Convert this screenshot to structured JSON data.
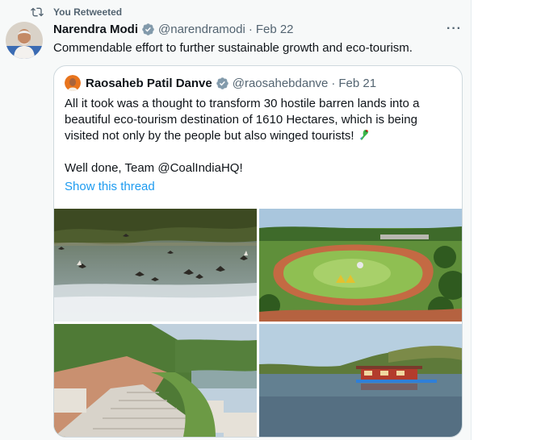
{
  "retweet": {
    "label": "You Retweeted",
    "icon": "retweet-icon"
  },
  "tweet": {
    "author_name": "Narendra Modi",
    "handle": "@narendramodi",
    "separator": "·",
    "date": "Feb 22",
    "text": "Commendable effort to further sustainable growth and eco-tourism.",
    "more_label": "···"
  },
  "quote": {
    "author_name": "Raosaheb Patil Danve",
    "handle": "@raosahebdanve",
    "separator": "·",
    "date": "Feb 21",
    "text_para1": "All it took was a thought to transform 30 hostile barren lands into a beautiful eco-tourism destination of 1610 Hectares, which is being visited not only by the people but also winged tourists!",
    "text_para2": "Well done, Team @CoalIndiaHQ!",
    "show_thread": "Show this thread",
    "emoji": "parrot-emoji"
  },
  "photos": [
    {
      "name": "photo-birds-over-lake"
    },
    {
      "name": "photo-eco-park-garden"
    },
    {
      "name": "photo-stairway-to-lake"
    },
    {
      "name": "photo-lake-houseboat"
    }
  ],
  "colors": {
    "link": "#1d9bf0",
    "verified": "#829aab",
    "secondary_text": "#536471",
    "border": "#cfd9de"
  }
}
